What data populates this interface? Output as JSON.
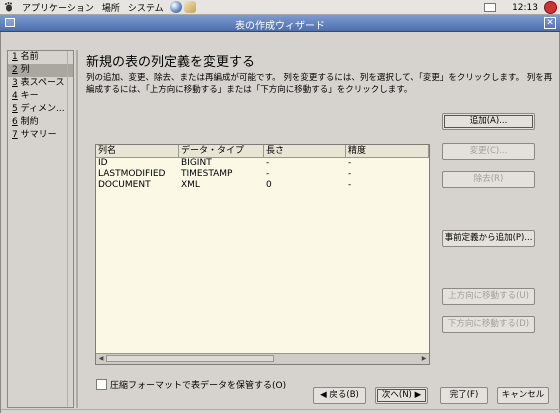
{
  "topbar": {
    "menus": [
      "アプリケーション",
      "場所",
      "システム"
    ],
    "clock": "12:13"
  },
  "window": {
    "title": "表の作成ウィザード"
  },
  "nav": {
    "items": [
      {
        "num": "1",
        "label": "名前"
      },
      {
        "num": "2",
        "label": "列"
      },
      {
        "num": "3",
        "label": "表スペース"
      },
      {
        "num": "4",
        "label": "キー"
      },
      {
        "num": "5",
        "label": "ディメン..."
      },
      {
        "num": "6",
        "label": "制約"
      },
      {
        "num": "7",
        "label": "サマリー"
      }
    ]
  },
  "main": {
    "heading": "新規の表の列定義を変更する",
    "description": "列の追加、変更、除去、または再編成が可能です。 列を変更するには、列を選択して、「変更」をクリックします。 列を再編成するには、「上方向に移動する」または「下方向に移動する」をクリックします。"
  },
  "table": {
    "columns": [
      "列名",
      "データ・タイプ",
      "長さ",
      "精度"
    ],
    "rows": [
      [
        "ID",
        "BIGINT",
        "-",
        "-"
      ],
      [
        "LASTMODIFIED",
        "TIMESTAMP",
        "-",
        "-"
      ],
      [
        "DOCUMENT",
        "XML",
        "0",
        "-"
      ]
    ]
  },
  "buttons": {
    "add": "追加(A)...",
    "change": "変更(C)...",
    "remove": "除去(R)",
    "add_predefined": "事前定義から追加(P)...",
    "move_up": "上方向に移動する(U)",
    "move_down": "下方向に移動する(D)"
  },
  "checkbox": {
    "label": "圧縮フォーマットで表データを保管する(O)"
  },
  "footer": {
    "back": "◀ 戻る(B)",
    "next": "次へ(N) ▶",
    "finish": "完了(F)",
    "cancel": "キャンセル"
  }
}
